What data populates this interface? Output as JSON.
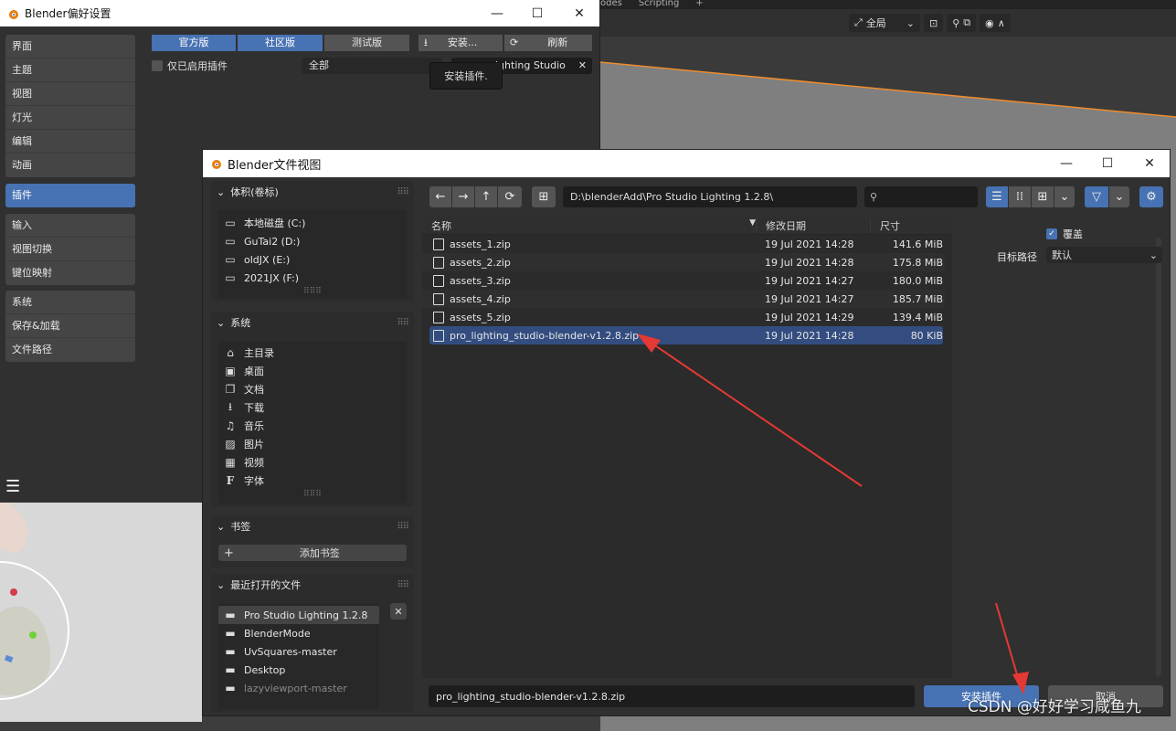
{
  "viewport": {
    "tabs": [
      "odes",
      "Scripting",
      "+"
    ],
    "orientation": "全局"
  },
  "prefs": {
    "title": "Blender偏好设置",
    "sidebar": {
      "group1": [
        "界面",
        "主题",
        "视图",
        "灯光",
        "编辑",
        "动画"
      ],
      "group2": [
        "插件"
      ],
      "group3": [
        "输入",
        "视图切换",
        "键位映射"
      ],
      "group4": [
        "系统",
        "保存&加载",
        "文件路径"
      ]
    },
    "tabs": {
      "official": "官方版",
      "community": "社区版",
      "testing": "测试版"
    },
    "install_label": "安装...",
    "refresh_label": "刷新",
    "enabled_only_label": "仅已启用插件",
    "category_value": "全部",
    "search_value": "ighting Studio",
    "tooltip": "安装插件."
  },
  "filebrowser": {
    "title": "Blender文件视图",
    "volumes": {
      "header": "体积(卷标)",
      "items": [
        "本地磁盘 (C:)",
        "GuTai2 (D:)",
        "oldJX (E:)",
        "2021JX (F:)"
      ]
    },
    "system": {
      "header": "系统",
      "items": [
        "主目录",
        "桌面",
        "文档",
        "下载",
        "音乐",
        "图片",
        "视频",
        "字体"
      ]
    },
    "bookmarks": {
      "header": "书签",
      "add_label": "添加书签"
    },
    "recent": {
      "header": "最近打开的文件",
      "items": [
        "Pro Studio Lighting 1.2.8",
        "BlenderMode",
        "UvSquares-master",
        "Desktop",
        "lazyviewport-master"
      ]
    },
    "path": "D:\\blenderAdd\\Pro Studio Lighting 1.2.8\\",
    "columns": {
      "name": "名称",
      "date": "修改日期",
      "size": "尺寸"
    },
    "files": [
      {
        "name": "assets_1.zip",
        "date": "19 Jul 2021 14:28",
        "size": "141.6 MiB"
      },
      {
        "name": "assets_2.zip",
        "date": "19 Jul 2021 14:28",
        "size": "175.8 MiB"
      },
      {
        "name": "assets_3.zip",
        "date": "19 Jul 2021 14:27",
        "size": "180.0 MiB"
      },
      {
        "name": "assets_4.zip",
        "date": "19 Jul 2021 14:27",
        "size": "185.7 MiB"
      },
      {
        "name": "assets_5.zip",
        "date": "19 Jul 2021 14:29",
        "size": "139.4 MiB"
      },
      {
        "name": "pro_lighting_studio-blender-v1.2.8.zip",
        "date": "19 Jul 2021 14:28",
        "size": "80 KiB"
      }
    ],
    "overwrite_label": "覆盖",
    "target_path_label": "目标路径",
    "target_path_value": "默认",
    "filename": "pro_lighting_studio-blender-v1.2.8.zip",
    "install_button": "安装插件",
    "cancel_button": "取消"
  },
  "watermark": "CSDN @好好学习咸鱼九",
  "colors": {
    "accent": "#4772b3",
    "arrow": "#e53935",
    "selected_row": "#334d80"
  }
}
